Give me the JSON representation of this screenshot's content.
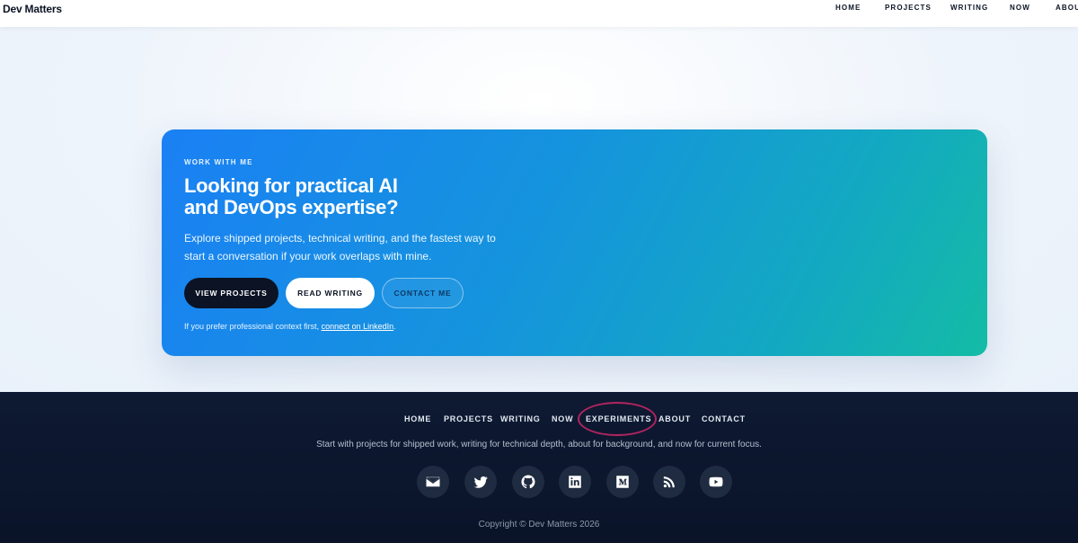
{
  "header": {
    "brand": "Dev Matters",
    "nav": [
      "HOME",
      "PROJECTS",
      "WRITING",
      "NOW",
      "ABOUT"
    ]
  },
  "cta": {
    "eyebrow": "WORK WITH ME",
    "title_line1": "Looking for practical AI",
    "title_line2": "and DevOps expertise?",
    "desc_line1": "Explore shipped projects, technical writing, and the fastest way to",
    "desc_line2": "start a conversation if your work overlaps with mine.",
    "buttons": {
      "projects": "VIEW PROJECTS",
      "writing": "READ WRITING",
      "contact": "CONTACT ME"
    },
    "note_prefix": "If you prefer professional context first, ",
    "note_link": "connect on LinkedIn",
    "note_suffix": "."
  },
  "footer": {
    "nav": [
      "HOME",
      "PROJECTS",
      "WRITING",
      "NOW",
      "EXPERIMENTS",
      "ABOUT",
      "CONTACT"
    ],
    "tagline": "Start with projects for shipped work, writing for technical depth, about for background, and now for current focus.",
    "social_icons": [
      "mail-icon",
      "twitter-icon",
      "github-icon",
      "linkedin-icon",
      "medium-icon",
      "rss-icon",
      "youtube-icon"
    ],
    "copyright": "Copyright © Dev Matters 2026"
  },
  "colors": {
    "highlight_ring": "#b0245f",
    "footer_bg": "#0e1a33",
    "cta_gradient_start": "#1a80f4",
    "cta_gradient_end": "#14bca5"
  }
}
